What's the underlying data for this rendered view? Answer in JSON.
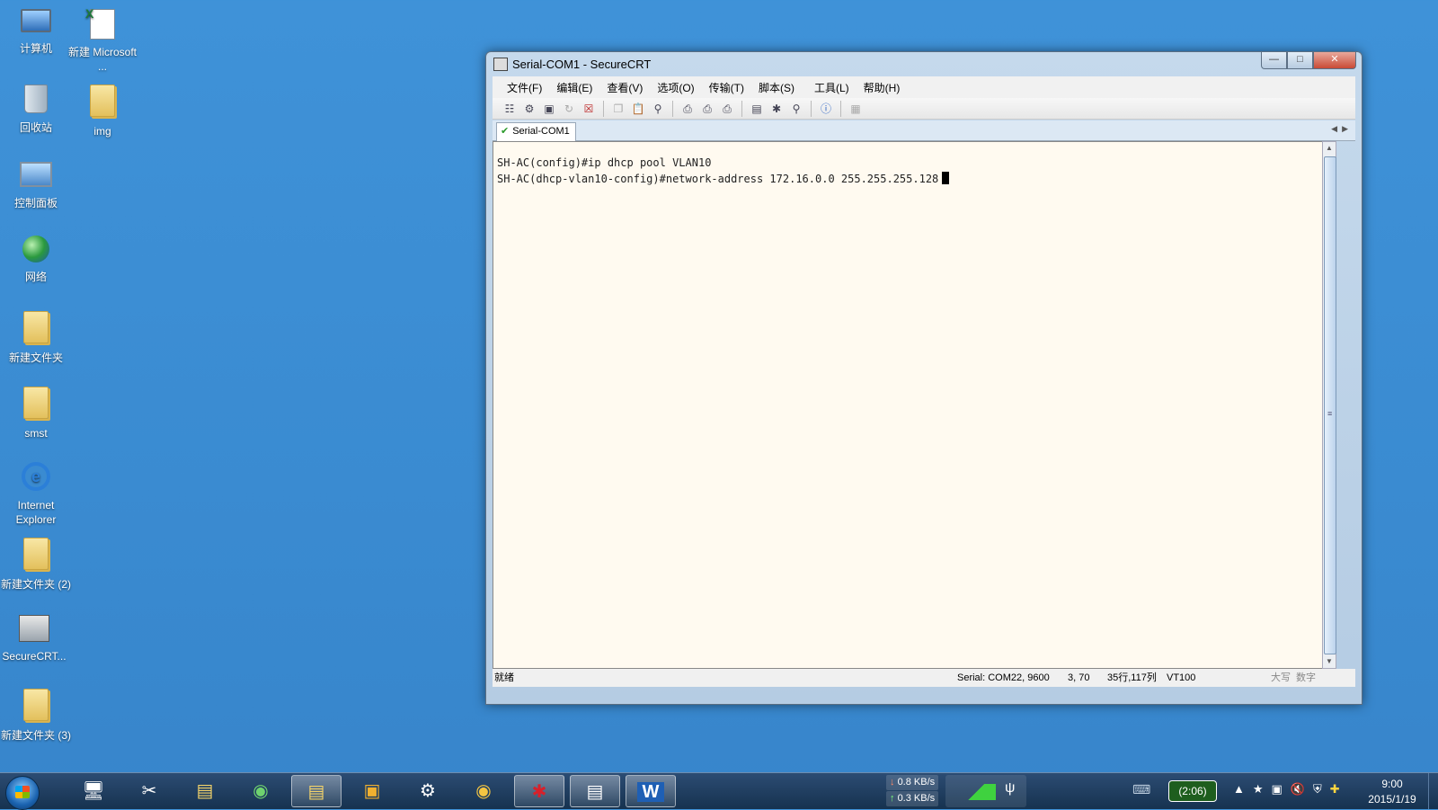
{
  "desktop": {
    "icons": [
      {
        "label": "计算机"
      },
      {
        "label": "新建 Microsoft ..."
      },
      {
        "label": "回收站"
      },
      {
        "label": "img"
      },
      {
        "label": "控制面板"
      },
      {
        "label": "网络"
      },
      {
        "label": "新建文件夹"
      },
      {
        "label": "smst"
      },
      {
        "label": "Internet Explorer"
      },
      {
        "label": "新建文件夹 (2)"
      },
      {
        "label": "SecureCRT..."
      },
      {
        "label": "新建文件夹 (3)"
      }
    ]
  },
  "window": {
    "title": "Serial-COM1 - SecureCRT",
    "menu": [
      "文件(F)",
      "编辑(E)",
      "查看(V)",
      "选项(O)",
      "传输(T)",
      "脚本(S)",
      "工具(L)",
      "帮助(H)"
    ],
    "tab": "Serial-COM1",
    "terminal_lines": [
      "SH-AC(config)#ip dhcp pool VLAN10",
      "SH-AC(dhcp-vlan10-config)#network-address 172.16.0.0 255.255.255.128"
    ],
    "status": {
      "ready": "就绪",
      "serial": "Serial: COM22, 9600",
      "position": "3, 70",
      "size": "35行,117列",
      "emulation": "VT100",
      "caps": "大写",
      "num": "数字"
    }
  },
  "taskbar": {
    "net_down": "0.8 KB/s",
    "net_up": "0.3 KB/s",
    "battery": "(2:06)",
    "time": "9:00",
    "date": "2015/1/19"
  }
}
